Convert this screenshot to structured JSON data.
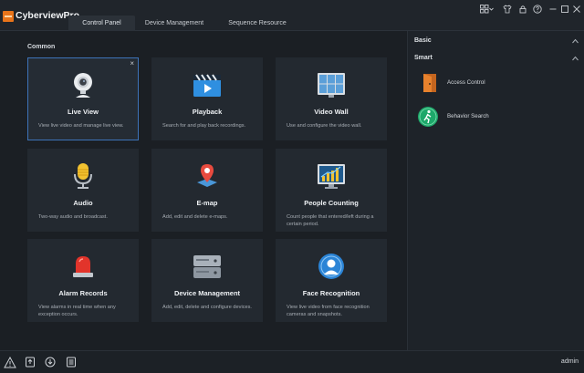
{
  "app": {
    "title": "CyberviewPro"
  },
  "tabs": [
    {
      "label": "Control Panel",
      "active": true
    },
    {
      "label": "Device Management",
      "active": false
    },
    {
      "label": "Sequence Resource",
      "active": false
    }
  ],
  "titlebar_icons": [
    "grid-menu-icon",
    "tshirt-skin-icon",
    "lock-icon",
    "help-icon",
    "minimize-icon",
    "maximize-icon",
    "close-icon"
  ],
  "main": {
    "section_label": "Common",
    "cards": [
      {
        "title": "Live View",
        "desc": "View live video and manage live view.",
        "icon": "camera-icon",
        "selected": true,
        "close": "×"
      },
      {
        "title": "Playback",
        "desc": "Search for and play back recordings.",
        "icon": "playback-icon",
        "selected": false
      },
      {
        "title": "Video Wall",
        "desc": "Use and configure the video wall.",
        "icon": "video-wall-icon",
        "selected": false
      },
      {
        "title": "Audio",
        "desc": "Two-way audio and broadcast.",
        "icon": "microphone-icon",
        "selected": false
      },
      {
        "title": "E-map",
        "desc": "Add, edit and delete e-maps.",
        "icon": "map-pin-icon",
        "selected": false
      },
      {
        "title": "People Counting",
        "desc": "Count people that entered/left during a certain period.",
        "icon": "people-counting-icon",
        "selected": false
      },
      {
        "title": "Alarm Records",
        "desc": "View alarms in real time when any exception occurs.",
        "icon": "alarm-light-icon",
        "selected": false
      },
      {
        "title": "Device Management",
        "desc": "Add, edit, delete and configure devices.",
        "icon": "server-icon",
        "selected": false
      },
      {
        "title": "Face Recognition",
        "desc": "View live video from face recognition cameras and snapshots.",
        "icon": "face-recognition-icon",
        "selected": false
      }
    ]
  },
  "right_panel": {
    "basic_label": "Basic",
    "smart_label": "Smart",
    "items": [
      {
        "label": "Access Control",
        "icon": "door-icon"
      },
      {
        "label": "Behavior Search",
        "icon": "running-person-icon"
      }
    ]
  },
  "bottom_bar": {
    "icons": [
      "warning-icon",
      "export-icon",
      "download-icon",
      "task-list-icon"
    ],
    "user": "admin"
  },
  "colors": {
    "accent": "#3d73b8",
    "logo": "#e8741a",
    "background": "#1b1f24"
  }
}
